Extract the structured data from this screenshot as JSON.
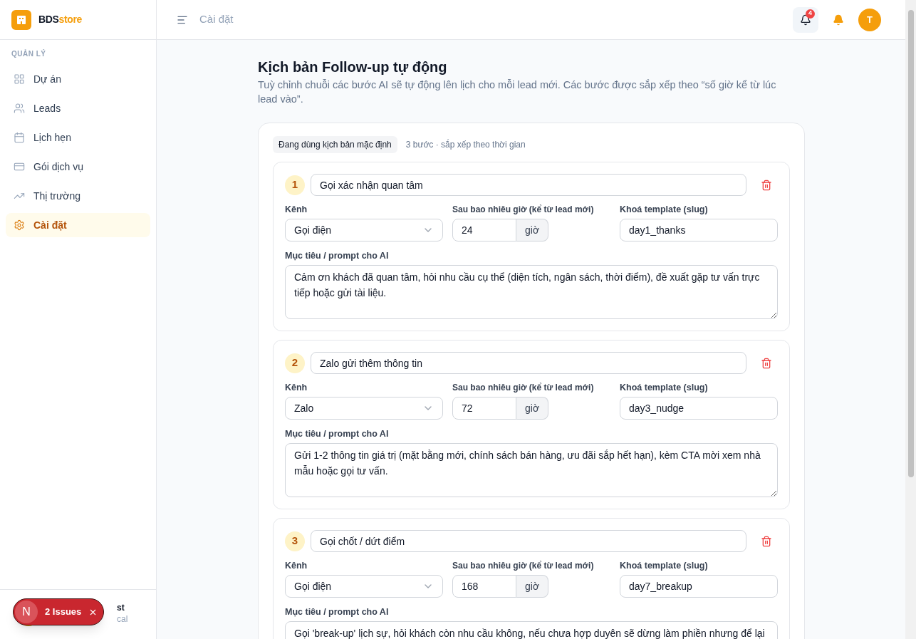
{
  "brand": {
    "name_part1": "BDS",
    "name_part2": "store"
  },
  "sidebar": {
    "section_title": "QUẢN LÝ",
    "items": [
      {
        "label": "Dự án",
        "selected": false
      },
      {
        "label": "Leads",
        "selected": false
      },
      {
        "label": "Lịch hẹn",
        "selected": false
      },
      {
        "label": "Gói dịch vụ",
        "selected": false
      },
      {
        "label": "Thị trường",
        "selected": false
      },
      {
        "label": "Cài đặt",
        "selected": true
      }
    ],
    "user": {
      "name": "st",
      "subtitle": "cal"
    }
  },
  "header": {
    "title": "Cài đặt",
    "notification_count": "4",
    "avatar_initial": "T"
  },
  "issues_badge": {
    "logo": "N",
    "label": "2 Issues"
  },
  "page": {
    "title": "Kịch bản Follow-up tự động",
    "description": "Tuỳ chỉnh chuỗi các bước AI sẽ tự động lên lịch cho mỗi lead mới. Các bước được sắp xếp theo “số giờ kể từ lúc lead vào”.",
    "status_tag": "Đang dùng kịch bản mặc định",
    "summary": "3 bước · sắp xếp theo thời gian"
  },
  "steps": [
    {
      "number": "1",
      "name": "Gọi xác nhận quan tâm",
      "channel_label": "Kênh",
      "channel": "Gọi điện",
      "hours_label": "Sau bao nhiêu giờ (kể từ lead mới)",
      "hours": "24",
      "hours_unit": "giờ",
      "template_label": "Khoá template (slug)",
      "template": "day1_thanks",
      "prompt_label": "Mục tiêu / prompt cho AI",
      "prompt": "Cảm ơn khách đã quan tâm, hỏi nhu cầu cụ thể (diện tích, ngân sách, thời điểm), đề xuất gặp tư vấn trực tiếp hoặc gửi tài liệu."
    },
    {
      "number": "2",
      "name": "Zalo gửi thêm thông tin",
      "channel_label": "Kênh",
      "channel": "Zalo",
      "hours_label": "Sau bao nhiêu giờ (kể từ lead mới)",
      "hours": "72",
      "hours_unit": "giờ",
      "template_label": "Khoá template (slug)",
      "template": "day3_nudge",
      "prompt_label": "Mục tiêu / prompt cho AI",
      "prompt": "Gửi 1-2 thông tin giá trị (mặt bằng mới, chính sách bán hàng, ưu đãi sắp hết hạn), kèm CTA mời xem nhà mẫu hoặc gọi tư vấn."
    },
    {
      "number": "3",
      "name": "Gọi chốt / dứt điểm",
      "channel_label": "Kênh",
      "channel": "Gọi điện",
      "hours_label": "Sau bao nhiêu giờ (kể từ lead mới)",
      "hours": "168",
      "hours_unit": "giờ",
      "template_label": "Khoá template (slug)",
      "template": "day7_breakup",
      "prompt_label": "Mục tiêu / prompt cho AI",
      "prompt": "Gọi 'break-up' lịch sự, hỏi khách còn nhu cầu không, nếu chưa hợp duyên sẽ dừng làm phiền nhưng để lại"
    }
  ]
}
